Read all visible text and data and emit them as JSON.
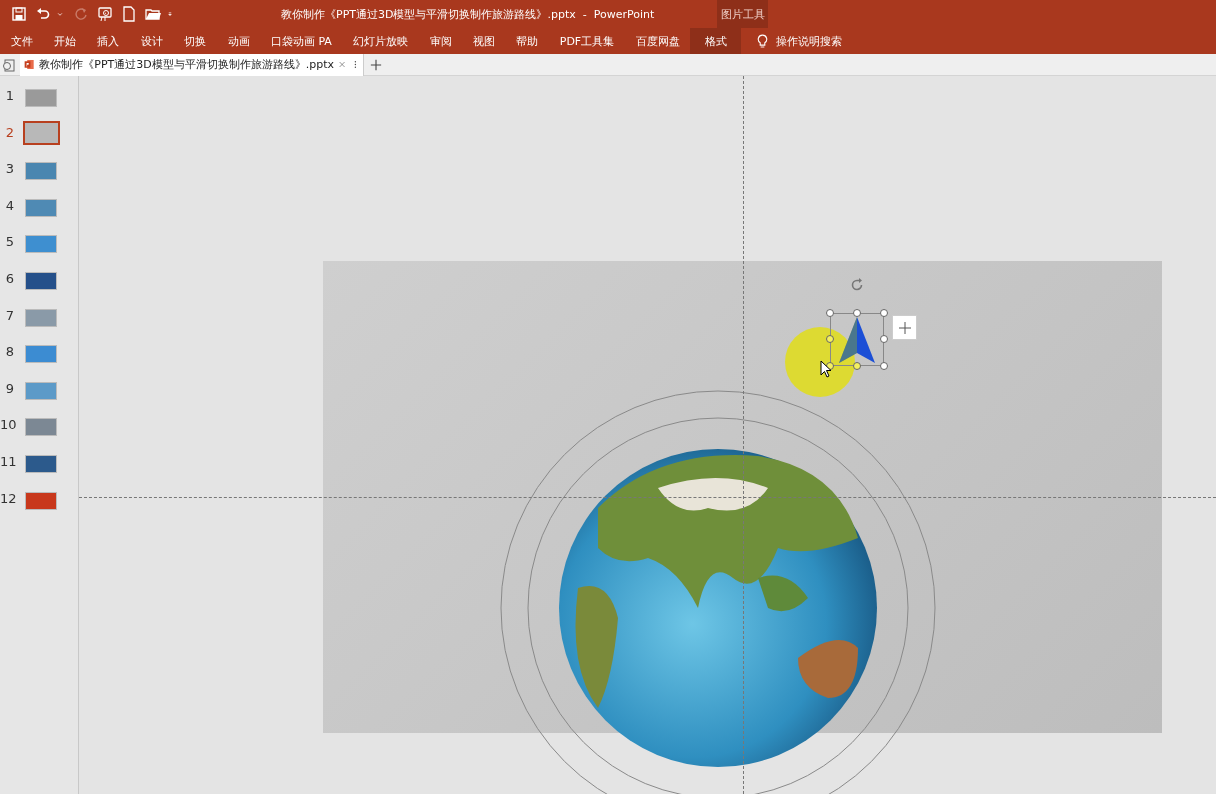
{
  "quick_access": [
    {
      "kind": "save",
      "disabled": false
    },
    {
      "kind": "undo",
      "disabled": false
    },
    {
      "kind": "caret",
      "disabled": false
    },
    {
      "kind": "redo",
      "disabled": true
    },
    {
      "kind": "present",
      "disabled": false
    },
    {
      "kind": "new",
      "disabled": false
    },
    {
      "kind": "open",
      "disabled": false
    },
    {
      "kind": "customize",
      "disabled": false
    }
  ],
  "window": {
    "title": "教你制作《PPT通过3D模型与平滑切换制作旅游路线》.pptx  -  PowerPoint",
    "context_group": "图片工具"
  },
  "ribbon_tabs": [
    {
      "label": "文件",
      "selected": false
    },
    {
      "label": "开始",
      "selected": false
    },
    {
      "label": "插入",
      "selected": false
    },
    {
      "label": "设计",
      "selected": false
    },
    {
      "label": "切换",
      "selected": false
    },
    {
      "label": "动画",
      "selected": false
    },
    {
      "label": "口袋动画 PA",
      "selected": false
    },
    {
      "label": "幻灯片放映",
      "selected": false
    },
    {
      "label": "审阅",
      "selected": false
    },
    {
      "label": "视图",
      "selected": false
    },
    {
      "label": "帮助",
      "selected": false
    },
    {
      "label": "PDF工具集",
      "selected": false
    },
    {
      "label": "百度网盘",
      "selected": false
    },
    {
      "label": "格式",
      "selected": true
    }
  ],
  "tell_me": {
    "label": "操作说明搜索"
  },
  "document_tab": {
    "title": "教你制作《PPT通过3D模型与平滑切换制作旅游路线》.pptx"
  },
  "slides": [
    {
      "number": "1",
      "selected": false,
      "color": "#9a9a9a"
    },
    {
      "number": "2",
      "selected": true,
      "color": "#b8b8b8"
    },
    {
      "number": "3",
      "selected": false,
      "color": "#4a86b0"
    },
    {
      "number": "4",
      "selected": false,
      "color": "#4f8ab4"
    },
    {
      "number": "5",
      "selected": false,
      "color": "#3e8fd0"
    },
    {
      "number": "6",
      "selected": false,
      "color": "#25508a"
    },
    {
      "number": "7",
      "selected": false,
      "color": "#8a9aa8"
    },
    {
      "number": "8",
      "selected": false,
      "color": "#3c8cd2"
    },
    {
      "number": "9",
      "selected": false,
      "color": "#5c9ac8"
    },
    {
      "number": "10",
      "selected": false,
      "color": "#7c8894"
    },
    {
      "number": "11",
      "selected": false,
      "color": "#2c5a8c"
    },
    {
      "number": "12",
      "selected": false,
      "color": "#c8381c"
    }
  ]
}
